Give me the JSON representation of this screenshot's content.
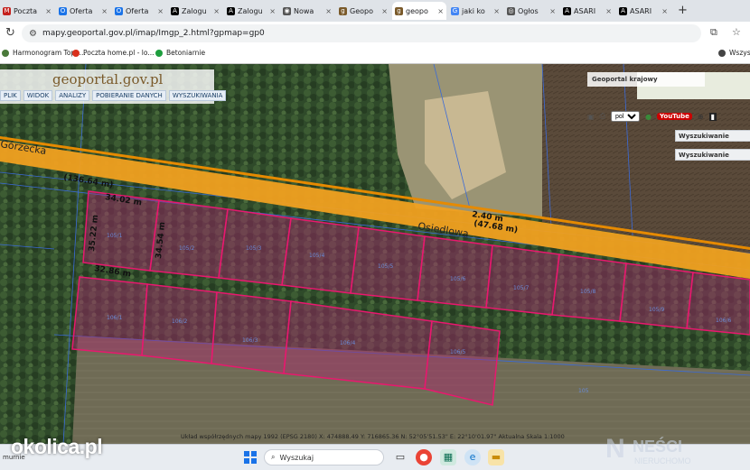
{
  "browser": {
    "tabs": [
      {
        "label": "Poczta",
        "color": "#c5221f",
        "glyph": "M"
      },
      {
        "label": "Oferta",
        "color": "#1a73e8",
        "glyph": "O"
      },
      {
        "label": "Oferta",
        "color": "#1a73e8",
        "glyph": "O"
      },
      {
        "label": "Zalogu",
        "color": "#000000",
        "glyph": "A"
      },
      {
        "label": "Zalogu",
        "color": "#000000",
        "glyph": "A"
      },
      {
        "label": "Nowa",
        "color": "#555555",
        "glyph": "◉"
      },
      {
        "label": "Geopo",
        "color": "#7a5a2a",
        "glyph": "g"
      },
      {
        "label": "geopo",
        "color": "#7a5a2a",
        "glyph": "g",
        "active": true
      },
      {
        "label": "jaki ko",
        "color": "#4285f4",
        "glyph": "G"
      },
      {
        "label": "Ogłos",
        "color": "#555555",
        "glyph": "◎"
      },
      {
        "label": "ASARI",
        "color": "#000000",
        "glyph": "A"
      },
      {
        "label": "ASARI",
        "color": "#000000",
        "glyph": "A"
      }
    ],
    "new_tab": "+",
    "url": "mapy.geoportal.gov.pl/imap/Imgp_2.html?gpmap=gp0",
    "bookmarks": [
      {
        "label": "Harmonogram Topo...",
        "color": "#4a7a3a"
      },
      {
        "label": "Poczta home.pl - lo...",
        "color": "#d9301c"
      },
      {
        "label": "Betoniarnie",
        "color": "#1e9e3e"
      },
      {
        "label": "Wszys",
        "color": "#444444"
      }
    ]
  },
  "geoportal": {
    "brand": "geoportal.gov.pl",
    "menu": [
      "PLIK",
      "WIDOK",
      "ANALIZY",
      "POBIERANIE DANYCH",
      "WYSZUKIWANIA"
    ],
    "overview_title": "Geoportal krajowy",
    "language": "pol",
    "youtube": "YouTube",
    "search_buttons": [
      "Wyszukiwanie",
      "Wyszukiwanie"
    ]
  },
  "map": {
    "streets": [
      "Górzecka",
      "Osiedlowa"
    ],
    "dimensions": [
      "(136.64 m)",
      "34.02 m",
      "35.22 m",
      "34.54 m",
      "32.86 m",
      "2.40 m",
      "(47.68 m)"
    ],
    "parcel_ids": [
      "105/1",
      "105/2",
      "105/3",
      "105/4",
      "105/5",
      "105/6",
      "105/7",
      "105/8",
      "105/9",
      "106/1",
      "106/2",
      "106/3",
      "106/4",
      "106/5",
      "106/6",
      "105"
    ],
    "coordinates_text": "Układ współrzędnych mapy 1992 (EPSG 2180)  X: 474888.49 Y: 716865.36  N: 52°05'51.53\" E: 22°10'01.97\"  Aktualna Skala 1:1000"
  },
  "taskbar": {
    "left_text": "murnie",
    "search": "Wyszukaj"
  },
  "watermarks": {
    "left": "okolica.pl",
    "right": "NEŚCI",
    "right_sub": "NIERUCHOMO"
  }
}
